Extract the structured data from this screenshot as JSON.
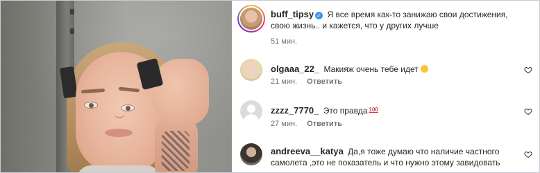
{
  "post": {
    "author": "buff_tipsy",
    "caption": "Я все время как-то занижаю свои достижения, свою жизнь.. и кажется, что у других лучше",
    "time": "51 мин."
  },
  "comments": [
    {
      "username": "olgaaa_22_",
      "text": "Макияж очень тебе идет",
      "emoji": "slightly-smiling-face",
      "time": "21 мин.",
      "reply_label": "Ответить"
    },
    {
      "username": "zzzz_7770_",
      "text": "Это правда",
      "badge": "100",
      "time": "27 мин.",
      "reply_label": "Ответить"
    },
    {
      "username": "andreeva__katya",
      "text": "Да,я тоже думаю что наличие частного самолета ,это не показатель и что нужно этому завидовать"
    }
  ],
  "colors": {
    "verified": "#3897f0",
    "meta": "#737373",
    "text": "#262626"
  },
  "icons": {
    "like": "heart-outline-icon",
    "verified": "verified-badge-icon"
  }
}
